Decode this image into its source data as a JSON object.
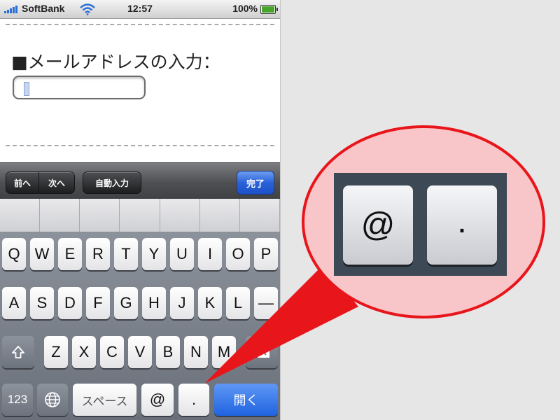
{
  "status_bar": {
    "carrier": "SoftBank",
    "time": "12:57",
    "battery_percent": "100%"
  },
  "form": {
    "email_label": "■メールアドレスの入力：",
    "email_value": ""
  },
  "form_assistant": {
    "prev": "前へ",
    "next": "次へ",
    "autofill": "自動入力",
    "done": "完了"
  },
  "keyboard": {
    "row1": [
      "Q",
      "W",
      "E",
      "R",
      "T",
      "Y",
      "U",
      "I",
      "O",
      "P"
    ],
    "row2": [
      "A",
      "S",
      "D",
      "F",
      "G",
      "H",
      "J",
      "K",
      "L",
      "—"
    ],
    "row3": [
      "Z",
      "X",
      "C",
      "V",
      "B",
      "N",
      "M"
    ],
    "bottom": {
      "numbers": "123",
      "space": "スペース",
      "at": "@",
      "dot": ".",
      "return": "開く"
    },
    "shift_icon": "shift-arrow-icon",
    "delete_icon": "backspace-icon",
    "globe_icon": "globe-icon"
  },
  "callout": {
    "at_key": "@",
    "dot_key": ".",
    "circle_color": "#e8151b",
    "fill_color": "#f8c6c8"
  }
}
